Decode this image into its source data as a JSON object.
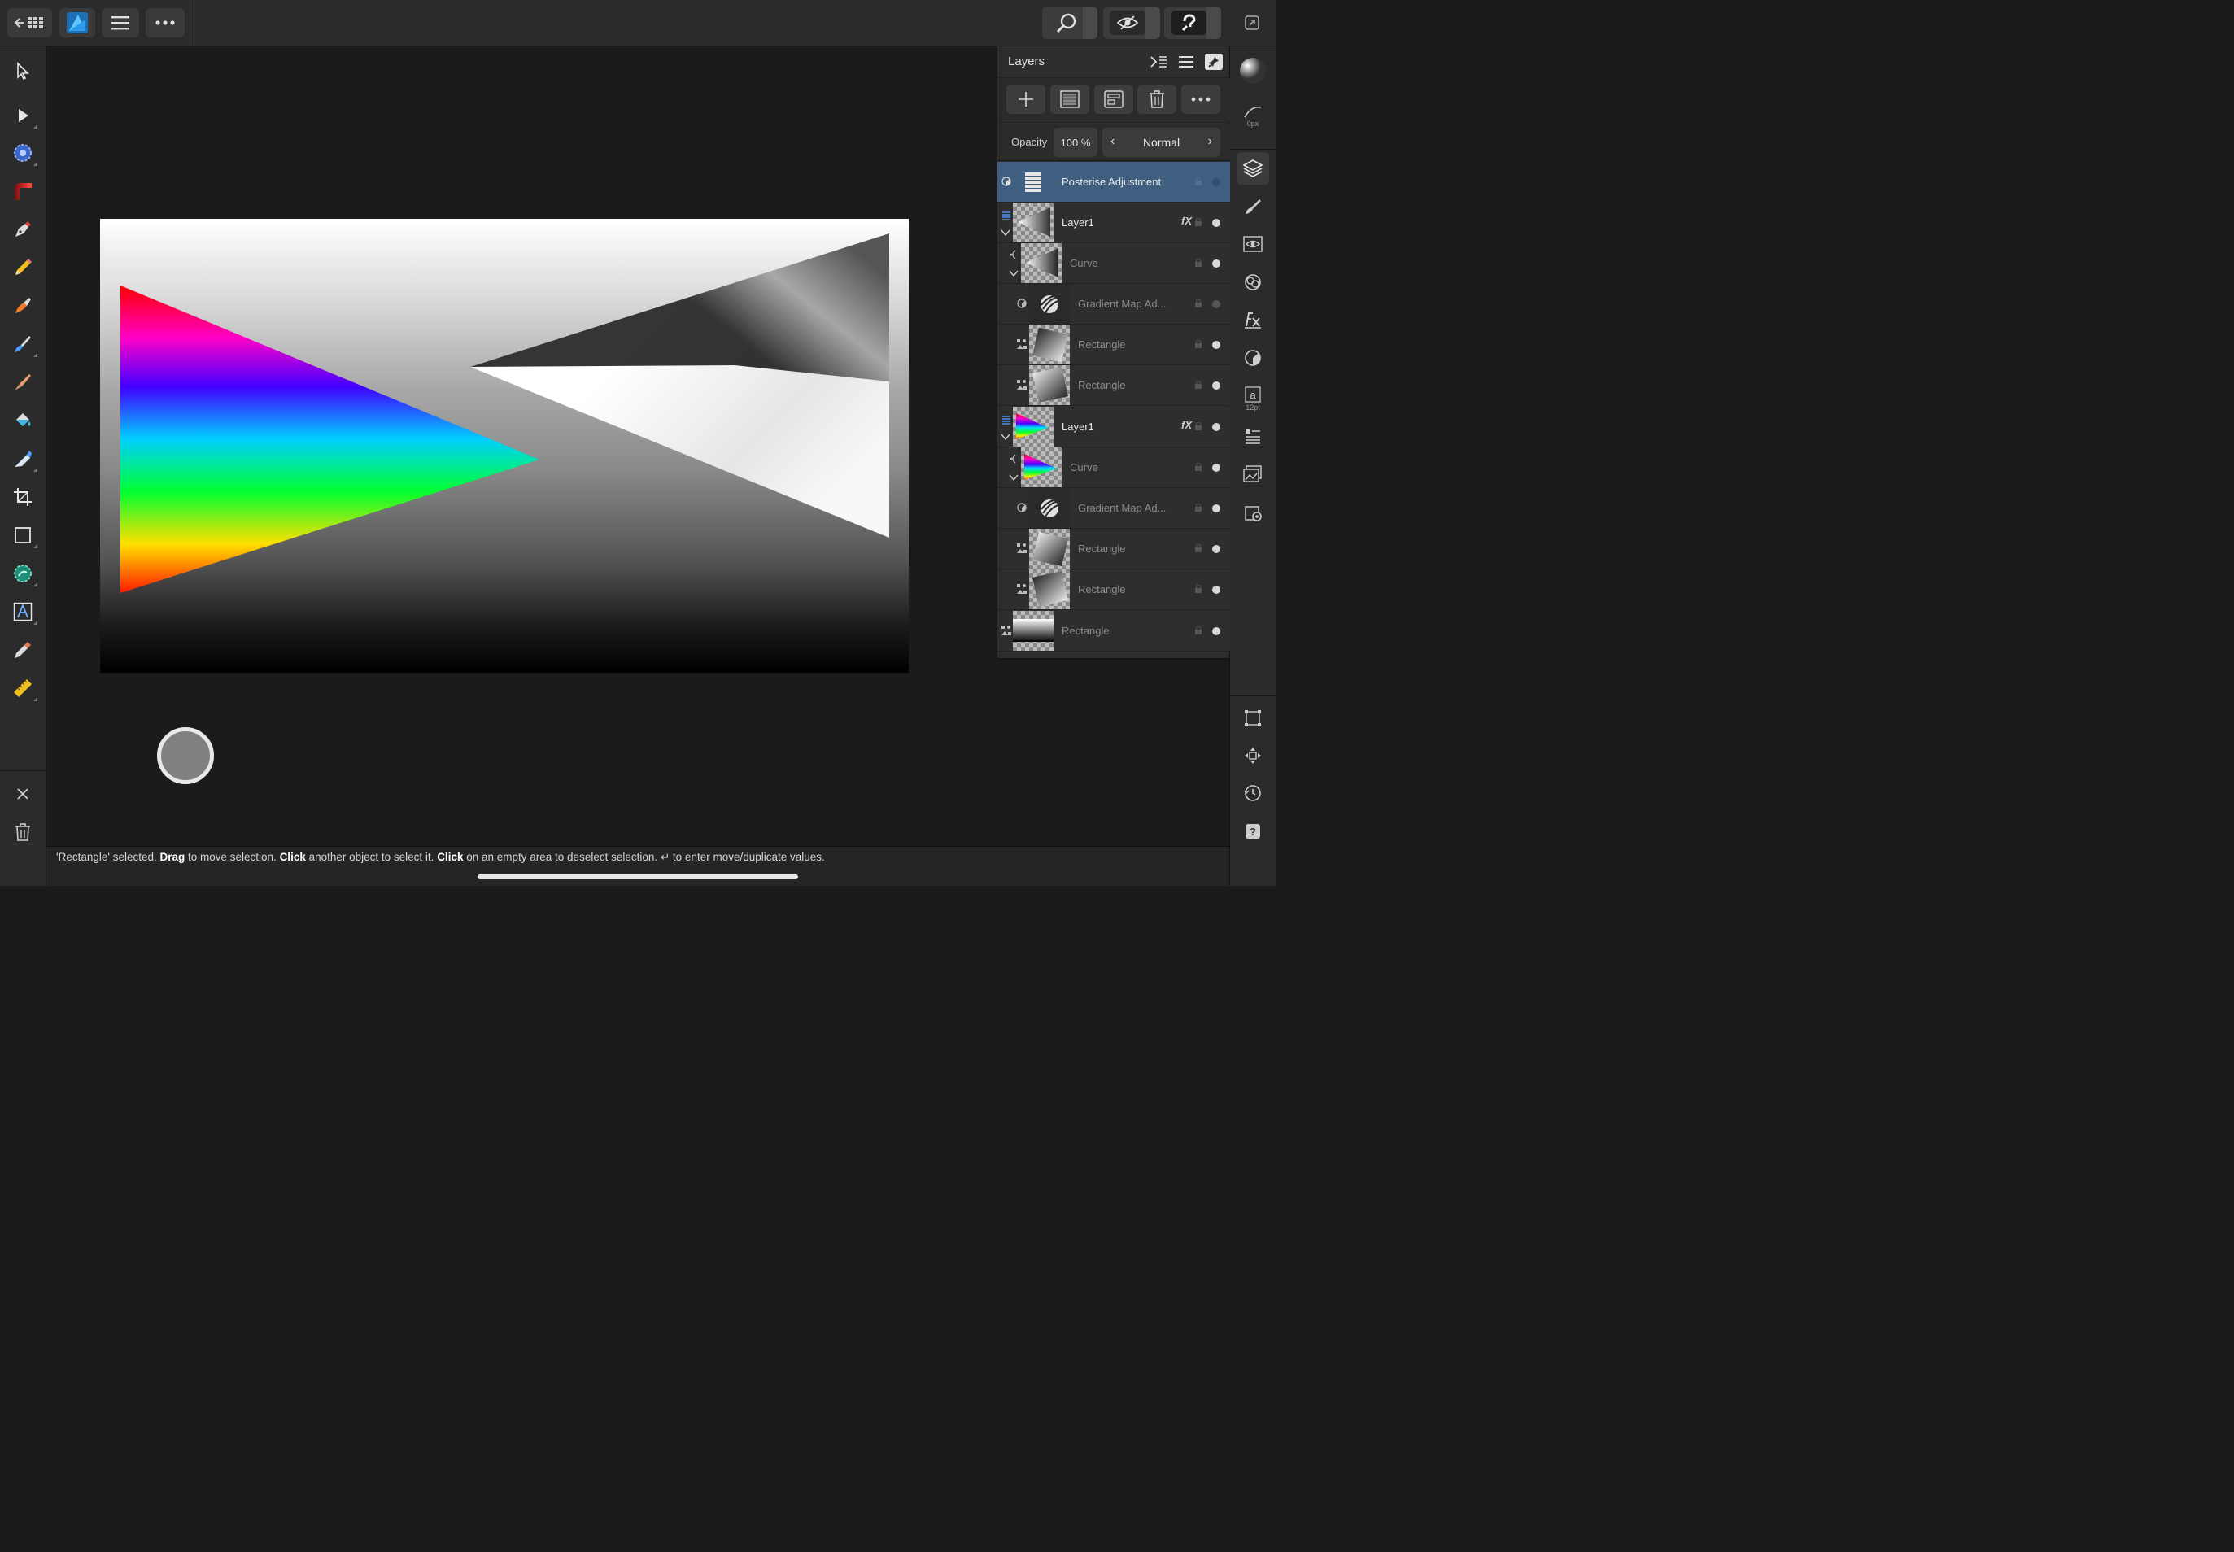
{
  "status": {
    "parts": [
      {
        "text": "'Rectangle' selected. ",
        "bold": false
      },
      {
        "text": "Drag",
        "bold": true
      },
      {
        "text": " to move selection. ",
        "bold": false
      },
      {
        "text": "Click",
        "bold": true
      },
      {
        "text": " another object to select it. ",
        "bold": false
      },
      {
        "text": "Click",
        "bold": true
      },
      {
        "text": " on an empty area to deselect selection. ↵ to enter move/duplicate values.",
        "bold": false
      }
    ]
  },
  "layers_panel": {
    "title": "Layers",
    "opacity_label": "Opacity",
    "opacity_value": "100 %",
    "blend_mode": "Normal",
    "rows": [
      {
        "name": "Posterise Adjustment",
        "selected": true,
        "dim": false,
        "fx": false,
        "visible": true
      },
      {
        "name": "Layer1",
        "selected": false,
        "dim": false,
        "fx": true,
        "fx_label": "fX",
        "visible": true
      },
      {
        "name": "Curve",
        "selected": false,
        "dim": true,
        "fx": false,
        "visible": true
      },
      {
        "name": "Gradient Map Ad...",
        "selected": false,
        "dim": true,
        "fx": false,
        "visible": false
      },
      {
        "name": "Rectangle",
        "selected": false,
        "dim": true,
        "fx": false,
        "visible": true
      },
      {
        "name": "Rectangle",
        "selected": false,
        "dim": true,
        "fx": false,
        "visible": true
      },
      {
        "name": "Layer1",
        "selected": false,
        "dim": false,
        "fx": true,
        "fx_label": "fX",
        "visible": true
      },
      {
        "name": "Curve",
        "selected": false,
        "dim": true,
        "fx": false,
        "visible": true
      },
      {
        "name": "Gradient Map Ad...",
        "selected": false,
        "dim": true,
        "fx": false,
        "visible": true
      },
      {
        "name": "Rectangle",
        "selected": false,
        "dim": true,
        "fx": false,
        "visible": true
      },
      {
        "name": "Rectangle",
        "selected": false,
        "dim": true,
        "fx": false,
        "visible": true
      },
      {
        "name": "Rectangle",
        "selected": false,
        "dim": true,
        "fx": false,
        "visible": true
      }
    ]
  },
  "studio": {
    "stroke_width": "0px",
    "font_size": "12pt"
  },
  "icons": {
    "top": [
      "back-grid-icon",
      "affinity-app-icon",
      "hamburger-menu-icon",
      "more-icon",
      "zoom-icon",
      "view-mode-icon",
      "snapping-icon",
      "fullscreen-icon"
    ],
    "left_tools": [
      "move-tool-icon",
      "node-tool-icon",
      "flood-select-icon",
      "gradient-tool-icon",
      "pen-tool-icon",
      "pencil-tool-icon",
      "vector-brush-icon",
      "paint-brush-icon",
      "pixel-brush-icon",
      "fill-tool-icon",
      "retouch-brush-icon",
      "crop-tool-icon",
      "rectangle-tool-icon",
      "selection-brush-icon",
      "text-tool-icon",
      "color-picker-icon",
      "measure-tool-icon",
      "close-icon",
      "trash-icon"
    ],
    "right_studio": [
      "color-icon",
      "stroke-icon",
      "layers-icon",
      "brushes-icon",
      "visibility-icon",
      "adjustments-icon",
      "fx-icon",
      "styles-icon",
      "text-style-icon",
      "character-icon",
      "navigator-icon",
      "settings-icon",
      "transform-icon",
      "move-icon",
      "history-icon",
      "help-icon"
    ]
  },
  "colors": {
    "selection": "#3f5f80",
    "panel": "#2e2e2e",
    "toolbar": "#2b2b2b",
    "accent": "#2d9cf0"
  }
}
